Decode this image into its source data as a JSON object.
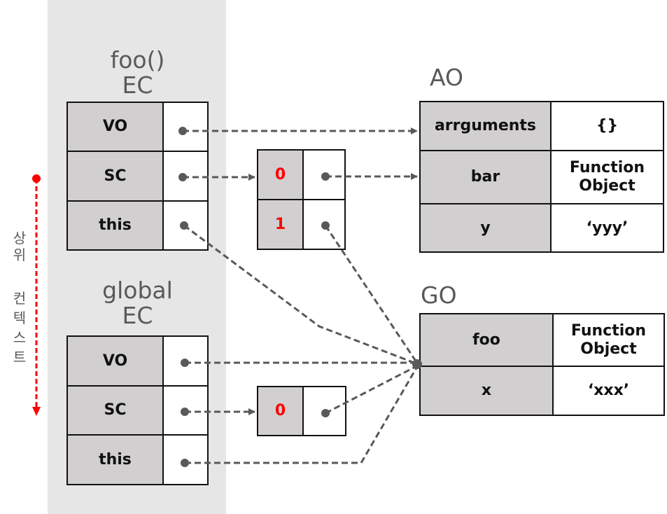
{
  "side_label": {
    "text": "상위 컨텍스트",
    "chars_top": [
      "상",
      "위"
    ],
    "chars_bottom": [
      "컨",
      "텍",
      "스",
      "트"
    ],
    "arrow_color": "#ff0000"
  },
  "foo_ec": {
    "title_line1": "foo()",
    "title_line2": "EC",
    "rows": [
      {
        "key": "VO"
      },
      {
        "key": "SC"
      },
      {
        "key": "this"
      }
    ]
  },
  "global_ec": {
    "title_line1": "global",
    "title_line2": "EC",
    "rows": [
      {
        "key": "VO"
      },
      {
        "key": "SC"
      },
      {
        "key": "this"
      }
    ]
  },
  "foo_scope_chain": {
    "indices": [
      "0",
      "1"
    ]
  },
  "global_scope_chain": {
    "indices": [
      "0"
    ]
  },
  "ao": {
    "title": "AO",
    "rows": [
      {
        "key": "arrguments",
        "value": "{}"
      },
      {
        "key": "bar",
        "value": "Function Object"
      },
      {
        "key": "y",
        "value": "‘yyy’"
      }
    ]
  },
  "go": {
    "title": "GO",
    "rows": [
      {
        "key": "foo",
        "value": "Function Object"
      },
      {
        "key": "x",
        "value": "‘xxx’"
      }
    ]
  },
  "colors": {
    "key_cell": "#d1cfd0",
    "connector": "#595959",
    "index_text": "#ff0000",
    "panel": "#e6e6e6"
  }
}
